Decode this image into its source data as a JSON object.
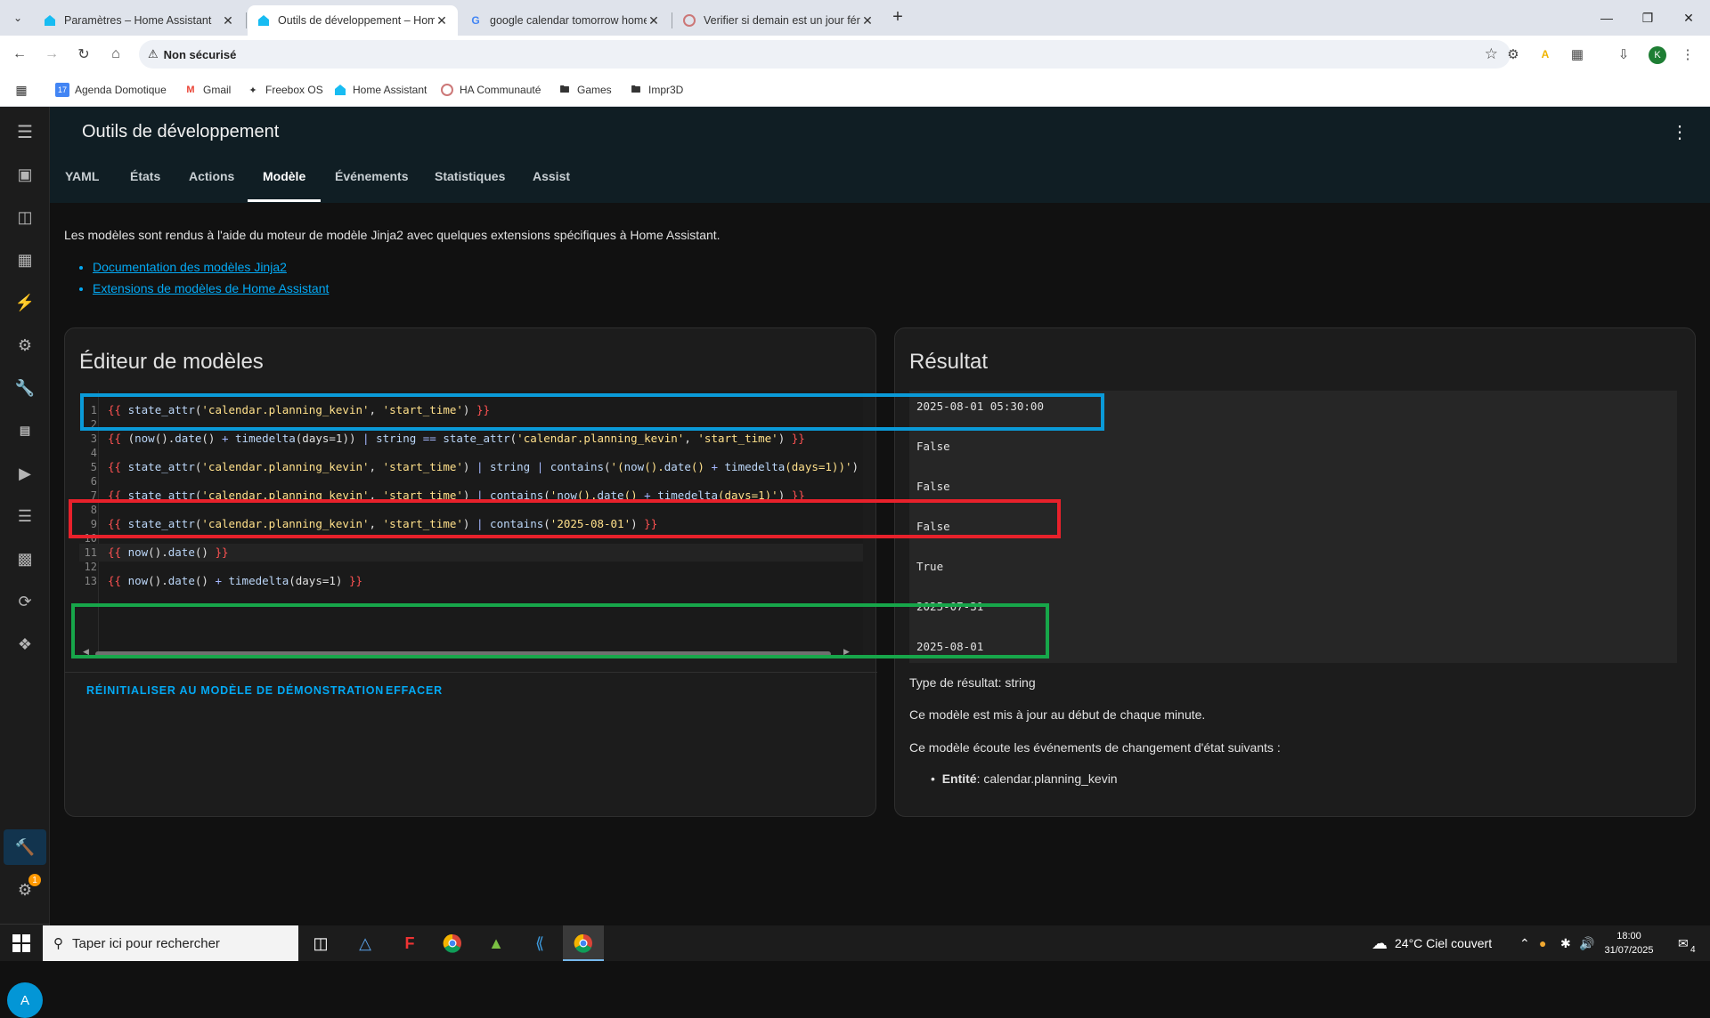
{
  "browser": {
    "tabs": [
      {
        "title": "Paramètres – Home Assistant",
        "favicon": "home-assistant-icon"
      },
      {
        "title": "Outils de développement – Home Assistant",
        "favicon": "home-assistant-icon"
      },
      {
        "title": "google calendar tomorrow home assistant",
        "favicon": "google-icon"
      },
      {
        "title": "Verifier si demain est un jour férié",
        "favicon": "community-icon"
      }
    ],
    "address": {
      "security_label": "Non sécurisé"
    },
    "bookmarks": [
      {
        "label": "Agenda Domotique",
        "icon": "calendar-icon"
      },
      {
        "label": "Gmail",
        "icon": "gmail-icon"
      },
      {
        "label": "Freebox OS",
        "icon": "freebox-icon"
      },
      {
        "label": "Home Assistant",
        "icon": "home-assistant-icon"
      },
      {
        "label": "HA Communauté",
        "icon": "community-icon"
      },
      {
        "label": "Games",
        "icon": "folder-icon"
      },
      {
        "label": "Impr3D",
        "icon": "folder-icon"
      }
    ],
    "profile_initial": "K"
  },
  "ha": {
    "title": "Outils de développement",
    "tabs": [
      "YAML",
      "États",
      "Actions",
      "Modèle",
      "Événements",
      "Statistiques",
      "Assist"
    ],
    "active_tab": "Modèle",
    "intro": "Les modèles sont rendus à l'aide du moteur de modèle Jinja2 avec quelques extensions spécifiques à Home Assistant.",
    "links": [
      "Documentation des modèles Jinja2",
      "Extensions de modèles de Home Assistant"
    ],
    "editor": {
      "title": "Éditeur de modèles",
      "line_numbers": [
        "1",
        "2",
        "3",
        "4",
        "5",
        "6",
        "7",
        "8",
        "9",
        "10",
        "11",
        "12",
        "13"
      ],
      "lines": [
        "{{ state_attr('calendar.planning_kevin', 'start_time') }}",
        "",
        "{{ (now().date() + timedelta(days=1)) | string == state_attr('calendar.planning_kevin', 'start_time') }}",
        "",
        "{{ state_attr('calendar.planning_kevin', 'start_time') | string | contains('(now().date() + timedelta(days=1))') }}",
        "",
        "{{ state_attr('calendar.planning_kevin', 'start_time') | contains('now().date() + timedelta(days=1)') }}",
        "",
        "{{ state_attr('calendar.planning_kevin', 'start_time') | contains('2025-08-01') }}",
        "",
        "{{ now().date() }}",
        "",
        "{{ now().date() + timedelta(days=1) }}"
      ],
      "reset_label": "RÉINITIALISER AU MODÈLE DE DÉMONSTRATION",
      "clear_label": "EFFACER"
    },
    "result": {
      "title": "Résultat",
      "lines": [
        "2025-08-01 05:30:00",
        "False",
        "False",
        "False",
        "True",
        "2025-07-31",
        "2025-08-01"
      ],
      "type_label": "Type de résultat: string",
      "update_note": "Ce modèle est mis à jour au début de chaque minute.",
      "listen_note": "Ce modèle écoute les événements de changement d'état suivants :",
      "entity_label": "Entité",
      "entity_value": ": calendar.planning_kevin"
    },
    "sidebar": {
      "icons": [
        "menu-icon",
        "map-icon",
        "logbook-icon",
        "dashboard-icon",
        "energy-icon",
        "settings-icon",
        "tools-icon",
        "hacs-icon",
        "media-icon",
        "history-icon",
        "terminal-icon",
        "esphome-icon",
        "compass-icon",
        "developer-tools-icon",
        "settings-icon",
        "bell-icon"
      ],
      "settings_badge": "1",
      "user_initial": "A"
    },
    "annotation_colors": {
      "blue": "#0a9ad8",
      "red": "#e8212b",
      "green": "#17a64a"
    }
  },
  "taskbar": {
    "search_placeholder": "Taper ici pour rechercher",
    "weather": "24°C  Ciel couvert",
    "time": "18:00",
    "date": "31/07/2025",
    "notifications": "4"
  }
}
